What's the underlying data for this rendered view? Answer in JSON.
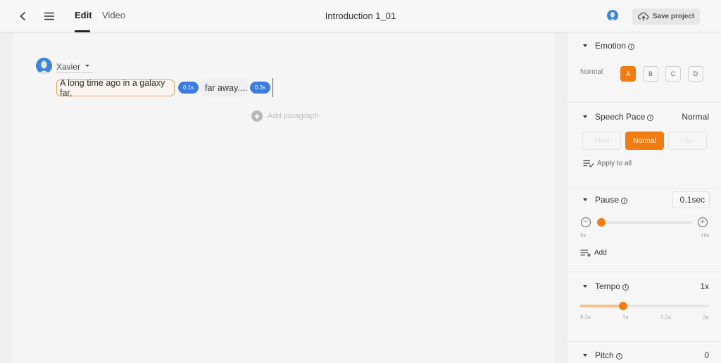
{
  "header": {
    "back_icon": "chevron-left-icon",
    "menu_icon": "hamburger-menu-icon",
    "tabs": [
      {
        "label": "Edit",
        "active": true
      },
      {
        "label": "Video",
        "active": false
      }
    ],
    "title": "Introduction 1_01",
    "save_label": "Save project",
    "save_icon": "cloud-upload-icon"
  },
  "editor": {
    "speaker": {
      "name": "Xavier"
    },
    "segments": [
      {
        "text": "A long time ago in a galaxy far,",
        "pause": "0.1s",
        "selected": true
      },
      {
        "text": "far away....",
        "pause": "0.3s",
        "selected": false
      }
    ],
    "add_paragraph_label": "Add paragraph"
  },
  "panel": {
    "emotion": {
      "title": "Emotion",
      "current_label": "Normal",
      "options": [
        "A",
        "B",
        "C",
        "D"
      ],
      "selected": "A"
    },
    "speech_pace": {
      "title": "Speech Pace",
      "value": "Normal",
      "options": [
        "Slow",
        "Normal",
        "Fast"
      ],
      "selected": "Normal",
      "apply_all_label": "Apply to all"
    },
    "pause": {
      "title": "Pause",
      "value": "0.1sec",
      "min_label": "0s",
      "max_label": "10s",
      "min": 0,
      "max": 10,
      "current": 0.1,
      "add_label": "Add"
    },
    "tempo": {
      "title": "Tempo",
      "value": "1x",
      "ticks": [
        "0.5x",
        "1x",
        "1.5x",
        "2x"
      ],
      "min": 0.5,
      "max": 2,
      "current": 1
    },
    "pitch": {
      "title": "Pitch",
      "value": "0"
    }
  },
  "colors": {
    "accent": "#f07d12",
    "accent_light": "#f6c08a",
    "pause_chip": "#3b7ddd",
    "selected_border": "#e0a35a"
  }
}
